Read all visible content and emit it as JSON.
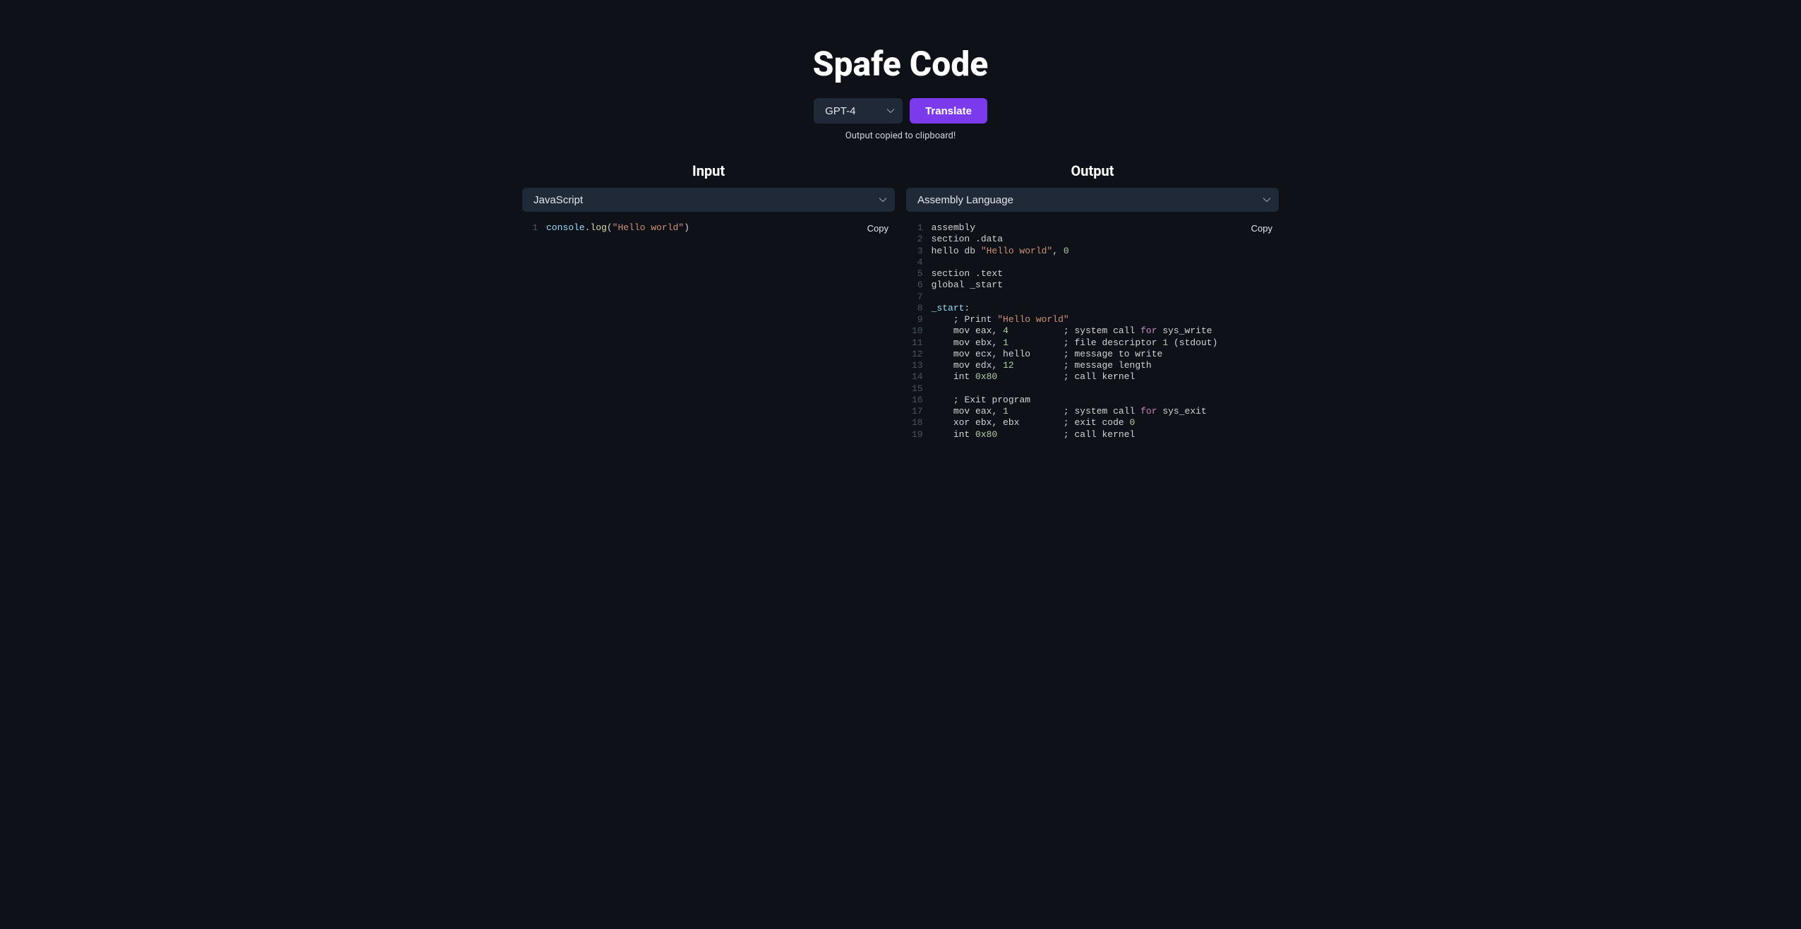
{
  "header": {
    "title": "Spafe Code",
    "model": "GPT-4",
    "translate_label": "Translate",
    "status": "Output copied to clipboard!"
  },
  "input": {
    "title": "Input",
    "language": "JavaScript",
    "copy_label": "Copy",
    "lines": [
      {
        "n": 1,
        "tokens": [
          {
            "t": "console",
            "c": "tok-prop"
          },
          {
            "t": ".",
            "c": "tok-punc"
          },
          {
            "t": "log",
            "c": "tok-fn"
          },
          {
            "t": "(",
            "c": "tok-punc"
          },
          {
            "t": "\"Hello world\"",
            "c": "tok-str"
          },
          {
            "t": ")",
            "c": "tok-punc"
          }
        ]
      }
    ]
  },
  "output": {
    "title": "Output",
    "language": "Assembly Language",
    "copy_label": "Copy",
    "lines": [
      {
        "n": 1,
        "tokens": [
          {
            "t": "assembly",
            "c": "tok-plain"
          }
        ]
      },
      {
        "n": 2,
        "tokens": [
          {
            "t": "section .data",
            "c": "tok-plain"
          }
        ]
      },
      {
        "n": 3,
        "tokens": [
          {
            "t": "hello db ",
            "c": "tok-plain"
          },
          {
            "t": "\"Hello world\"",
            "c": "tok-str"
          },
          {
            "t": ",",
            "c": "tok-punc"
          },
          {
            "t": " ",
            "c": "tok-plain"
          },
          {
            "t": "0",
            "c": "tok-num"
          }
        ]
      },
      {
        "n": 4,
        "tokens": []
      },
      {
        "n": 5,
        "tokens": [
          {
            "t": "section .text",
            "c": "tok-plain"
          }
        ]
      },
      {
        "n": 6,
        "tokens": [
          {
            "t": "global _start",
            "c": "tok-plain"
          }
        ]
      },
      {
        "n": 7,
        "tokens": []
      },
      {
        "n": 8,
        "tokens": [
          {
            "t": "_start",
            "c": "tok-id"
          },
          {
            "t": ":",
            "c": "tok-punc"
          }
        ]
      },
      {
        "n": 9,
        "tokens": [
          {
            "t": "    ",
            "c": "tok-plain"
          },
          {
            "t": ";",
            "c": "tok-punc"
          },
          {
            "t": " Print ",
            "c": "tok-plain"
          },
          {
            "t": "\"Hello world\"",
            "c": "tok-str"
          }
        ]
      },
      {
        "n": 10,
        "tokens": [
          {
            "t": "    mov eax",
            "c": "tok-plain"
          },
          {
            "t": ",",
            "c": "tok-punc"
          },
          {
            "t": " ",
            "c": "tok-plain"
          },
          {
            "t": "4",
            "c": "tok-num"
          },
          {
            "t": "          ",
            "c": "tok-plain"
          },
          {
            "t": ";",
            "c": "tok-punc"
          },
          {
            "t": " system call ",
            "c": "tok-plain"
          },
          {
            "t": "for",
            "c": "tok-kw"
          },
          {
            "t": " sys_write",
            "c": "tok-plain"
          }
        ]
      },
      {
        "n": 11,
        "tokens": [
          {
            "t": "    mov ebx",
            "c": "tok-plain"
          },
          {
            "t": ",",
            "c": "tok-punc"
          },
          {
            "t": " ",
            "c": "tok-plain"
          },
          {
            "t": "1",
            "c": "tok-num"
          },
          {
            "t": "          ",
            "c": "tok-plain"
          },
          {
            "t": ";",
            "c": "tok-punc"
          },
          {
            "t": " file descriptor ",
            "c": "tok-plain"
          },
          {
            "t": "1",
            "c": "tok-num"
          },
          {
            "t": " ",
            "c": "tok-plain"
          },
          {
            "t": "(",
            "c": "tok-punc"
          },
          {
            "t": "stdout",
            "c": "tok-plain"
          },
          {
            "t": ")",
            "c": "tok-punc"
          }
        ]
      },
      {
        "n": 12,
        "tokens": [
          {
            "t": "    mov ecx",
            "c": "tok-plain"
          },
          {
            "t": ",",
            "c": "tok-punc"
          },
          {
            "t": " hello      ",
            "c": "tok-plain"
          },
          {
            "t": ";",
            "c": "tok-punc"
          },
          {
            "t": " message to write",
            "c": "tok-plain"
          }
        ]
      },
      {
        "n": 13,
        "tokens": [
          {
            "t": "    mov edx",
            "c": "tok-plain"
          },
          {
            "t": ",",
            "c": "tok-punc"
          },
          {
            "t": " ",
            "c": "tok-plain"
          },
          {
            "t": "12",
            "c": "tok-num"
          },
          {
            "t": "         ",
            "c": "tok-plain"
          },
          {
            "t": ";",
            "c": "tok-punc"
          },
          {
            "t": " message length",
            "c": "tok-plain"
          }
        ]
      },
      {
        "n": 14,
        "tokens": [
          {
            "t": "    int ",
            "c": "tok-plain"
          },
          {
            "t": "0x80",
            "c": "tok-num"
          },
          {
            "t": "            ",
            "c": "tok-plain"
          },
          {
            "t": ";",
            "c": "tok-punc"
          },
          {
            "t": " call kernel",
            "c": "tok-plain"
          }
        ]
      },
      {
        "n": 15,
        "tokens": []
      },
      {
        "n": 16,
        "tokens": [
          {
            "t": "    ",
            "c": "tok-plain"
          },
          {
            "t": ";",
            "c": "tok-punc"
          },
          {
            "t": " Exit program",
            "c": "tok-plain"
          }
        ]
      },
      {
        "n": 17,
        "tokens": [
          {
            "t": "    mov eax",
            "c": "tok-plain"
          },
          {
            "t": ",",
            "c": "tok-punc"
          },
          {
            "t": " ",
            "c": "tok-plain"
          },
          {
            "t": "1",
            "c": "tok-num"
          },
          {
            "t": "          ",
            "c": "tok-plain"
          },
          {
            "t": ";",
            "c": "tok-punc"
          },
          {
            "t": " system call ",
            "c": "tok-plain"
          },
          {
            "t": "for",
            "c": "tok-kw"
          },
          {
            "t": " sys_exit",
            "c": "tok-plain"
          }
        ]
      },
      {
        "n": 18,
        "tokens": [
          {
            "t": "    xor ebx",
            "c": "tok-plain"
          },
          {
            "t": ",",
            "c": "tok-punc"
          },
          {
            "t": " ebx        ",
            "c": "tok-plain"
          },
          {
            "t": ";",
            "c": "tok-punc"
          },
          {
            "t": " exit code ",
            "c": "tok-plain"
          },
          {
            "t": "0",
            "c": "tok-num"
          }
        ]
      },
      {
        "n": 19,
        "tokens": [
          {
            "t": "    int ",
            "c": "tok-plain"
          },
          {
            "t": "0x80",
            "c": "tok-num"
          },
          {
            "t": "            ",
            "c": "tok-plain"
          },
          {
            "t": ";",
            "c": "tok-punc"
          },
          {
            "t": " call kernel",
            "c": "tok-plain"
          }
        ]
      }
    ]
  }
}
